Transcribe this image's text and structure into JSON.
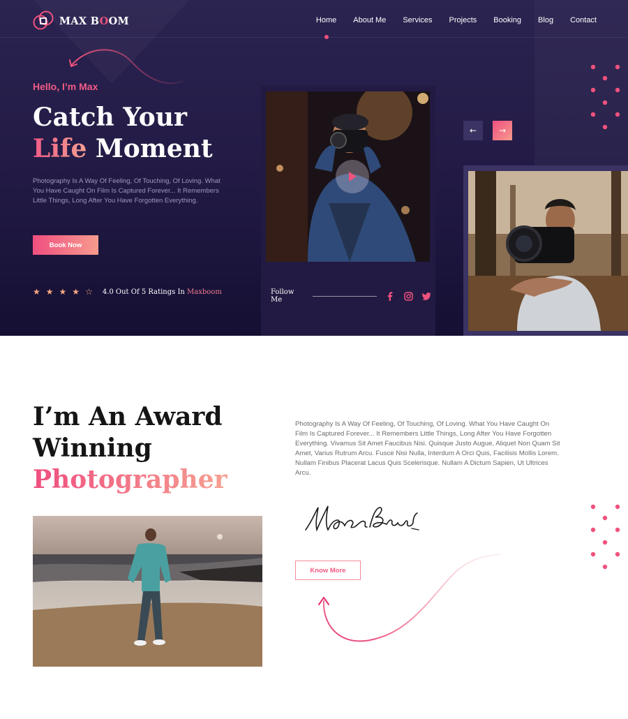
{
  "brand": {
    "part1": "MAX B",
    "highlight": "O",
    "part2": "OM",
    "accent": "#f0527d"
  },
  "nav": [
    {
      "label": "Home",
      "active": true
    },
    {
      "label": "About Me"
    },
    {
      "label": "Services"
    },
    {
      "label": "Projects"
    },
    {
      "label": "Booking"
    },
    {
      "label": "Blog"
    },
    {
      "label": "Contact"
    }
  ],
  "hero": {
    "greeting": "Hello, I’m Max",
    "headline_line1": "Catch Your",
    "headline_accent": "Life",
    "headline_rest": " Moment",
    "description": "Photography Is A Way Of Feeling, Of Touching, Of Loving. What You Have Caught On Film Is Captured Forever... It Remembers Little Things, Long After You Have Forgotten Everything.",
    "cta": "Book Now",
    "rating": {
      "value": 4,
      "max": 5,
      "text": "4.0 Out Of 5 Ratings In ",
      "brand": "Maxboom"
    },
    "video": {
      "play_icon": "play-icon"
    },
    "follow": {
      "label": "Follow Me",
      "icons": [
        "facebook-icon",
        "instagram-icon",
        "twitter-icon"
      ]
    },
    "slider": {
      "prev": "←",
      "next": "→"
    }
  },
  "about": {
    "title_pre": "I’m An ",
    "title_bold": "Award",
    "title_line2": "Winning",
    "title_accent": "Photographer",
    "description": "Photography Is A Way Of Feeling, Of Touching, Of Loving. What You Have Caught On Film Is Captured Forever... It Remembers Little Things, Long After You Have Forgotten Everything. Vivamus Sit Amet Faucibus Nisi. Quisque Justo Augue, Aliquet Non Quam Sit Amet, Varius Rutrum Arcu. Fusce Nisi Nulla, Interdum A Orci Quis, Facilisis Mollis Lorem.  Nullam Finibus Placerat Lacus Quis Scelerisque. Nullam A Dictum Sapien, Ut Ultrices Arcu.",
    "signature": "Max Bruch",
    "cta": "Know More"
  },
  "colors": {
    "hero_bg": "#241c47",
    "accent": "#ef4f7f",
    "accent_light": "#f79b8e"
  }
}
